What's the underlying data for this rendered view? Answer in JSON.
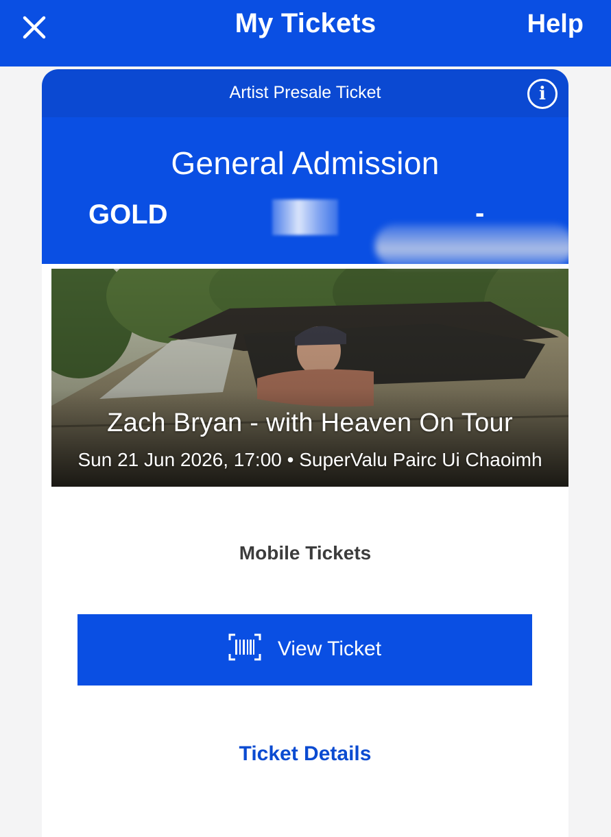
{
  "topbar": {
    "close_icon": "close-icon",
    "title": "My Tickets",
    "help": "Help",
    "background": "#0a4fe3"
  },
  "ticket": {
    "presale_label": "Artist Presale Ticket",
    "info_icon": "info-icon",
    "info_glyph": "i",
    "admission_type": "General Admission",
    "tier": "GOLD",
    "separator": "-",
    "event_title": "Zach Bryan - with Heaven On Tour",
    "event_meta": "Sun 21 Jun 2026, 17:00 • SuperValu Pairc Ui Chaoimh",
    "mobile_tickets_label": "Mobile Tickets",
    "view_ticket": {
      "label": "View Ticket",
      "icon": "barcode-icon"
    },
    "details_link": "Ticket Details"
  },
  "colors": {
    "brand_blue": "#0a4fe3",
    "header_blue": "#0b49d2",
    "link_blue": "#0b4bd1"
  }
}
